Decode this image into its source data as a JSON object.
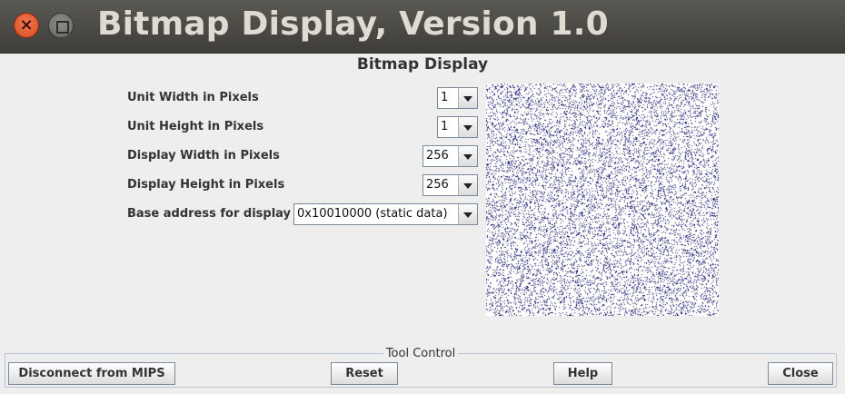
{
  "window": {
    "title": "Bitmap Display, Version 1.0"
  },
  "panel": {
    "title": "Bitmap Display",
    "settings": [
      {
        "label": "Unit Width in Pixels",
        "value": "1"
      },
      {
        "label": "Unit Height in Pixels",
        "value": "1"
      },
      {
        "label": "Display Width in Pixels",
        "value": "256"
      },
      {
        "label": "Display Height in Pixels",
        "value": "256"
      },
      {
        "label": "Base address for display",
        "value": "0x10010000 (static data)"
      }
    ]
  },
  "bitmap": {
    "background_color": "#ffffff",
    "pixel_color": "#1a1a6e"
  },
  "tool_control": {
    "title": "Tool Control",
    "buttons": {
      "disconnect": "Disconnect from MIPS",
      "reset": "Reset",
      "help": "Help",
      "close": "Close"
    }
  }
}
